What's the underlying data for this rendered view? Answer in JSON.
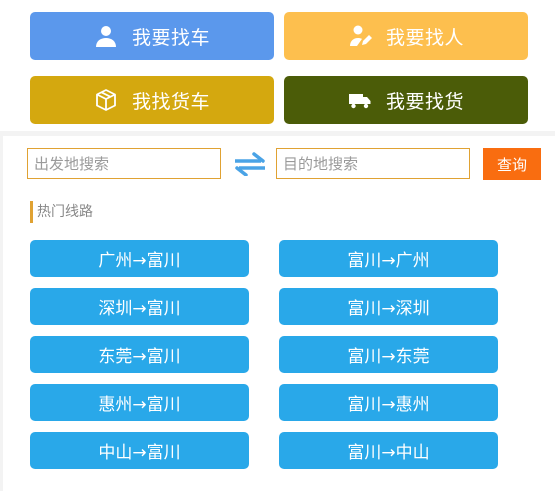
{
  "nav_buttons": [
    {
      "label": "我要找车",
      "color": "#5b98ec",
      "icon": "person-icon"
    },
    {
      "label": "我要找人",
      "color": "#fdbf4e",
      "icon": "person-edit-icon"
    },
    {
      "label": "我找货车",
      "color": "#d4a80f",
      "icon": "box-icon"
    },
    {
      "label": "我要找货",
      "color": "#4b5c08",
      "icon": "truck-icon"
    }
  ],
  "search": {
    "from_placeholder": "出发地搜索",
    "to_placeholder": "目的地搜索",
    "swap_icon": "swap-arrows-icon",
    "swap_color": "#4aa3e6",
    "query_label": "查询",
    "query_color": "#f96d10"
  },
  "hot_routes": {
    "title": "热门线路",
    "items": [
      "广州→富川",
      "富川→广州",
      "深圳→富川",
      "富川→深圳",
      "东莞→富川",
      "富川→东莞",
      "惠州→富川",
      "富川→惠州",
      "中山→富川",
      "富川→中山"
    ]
  }
}
